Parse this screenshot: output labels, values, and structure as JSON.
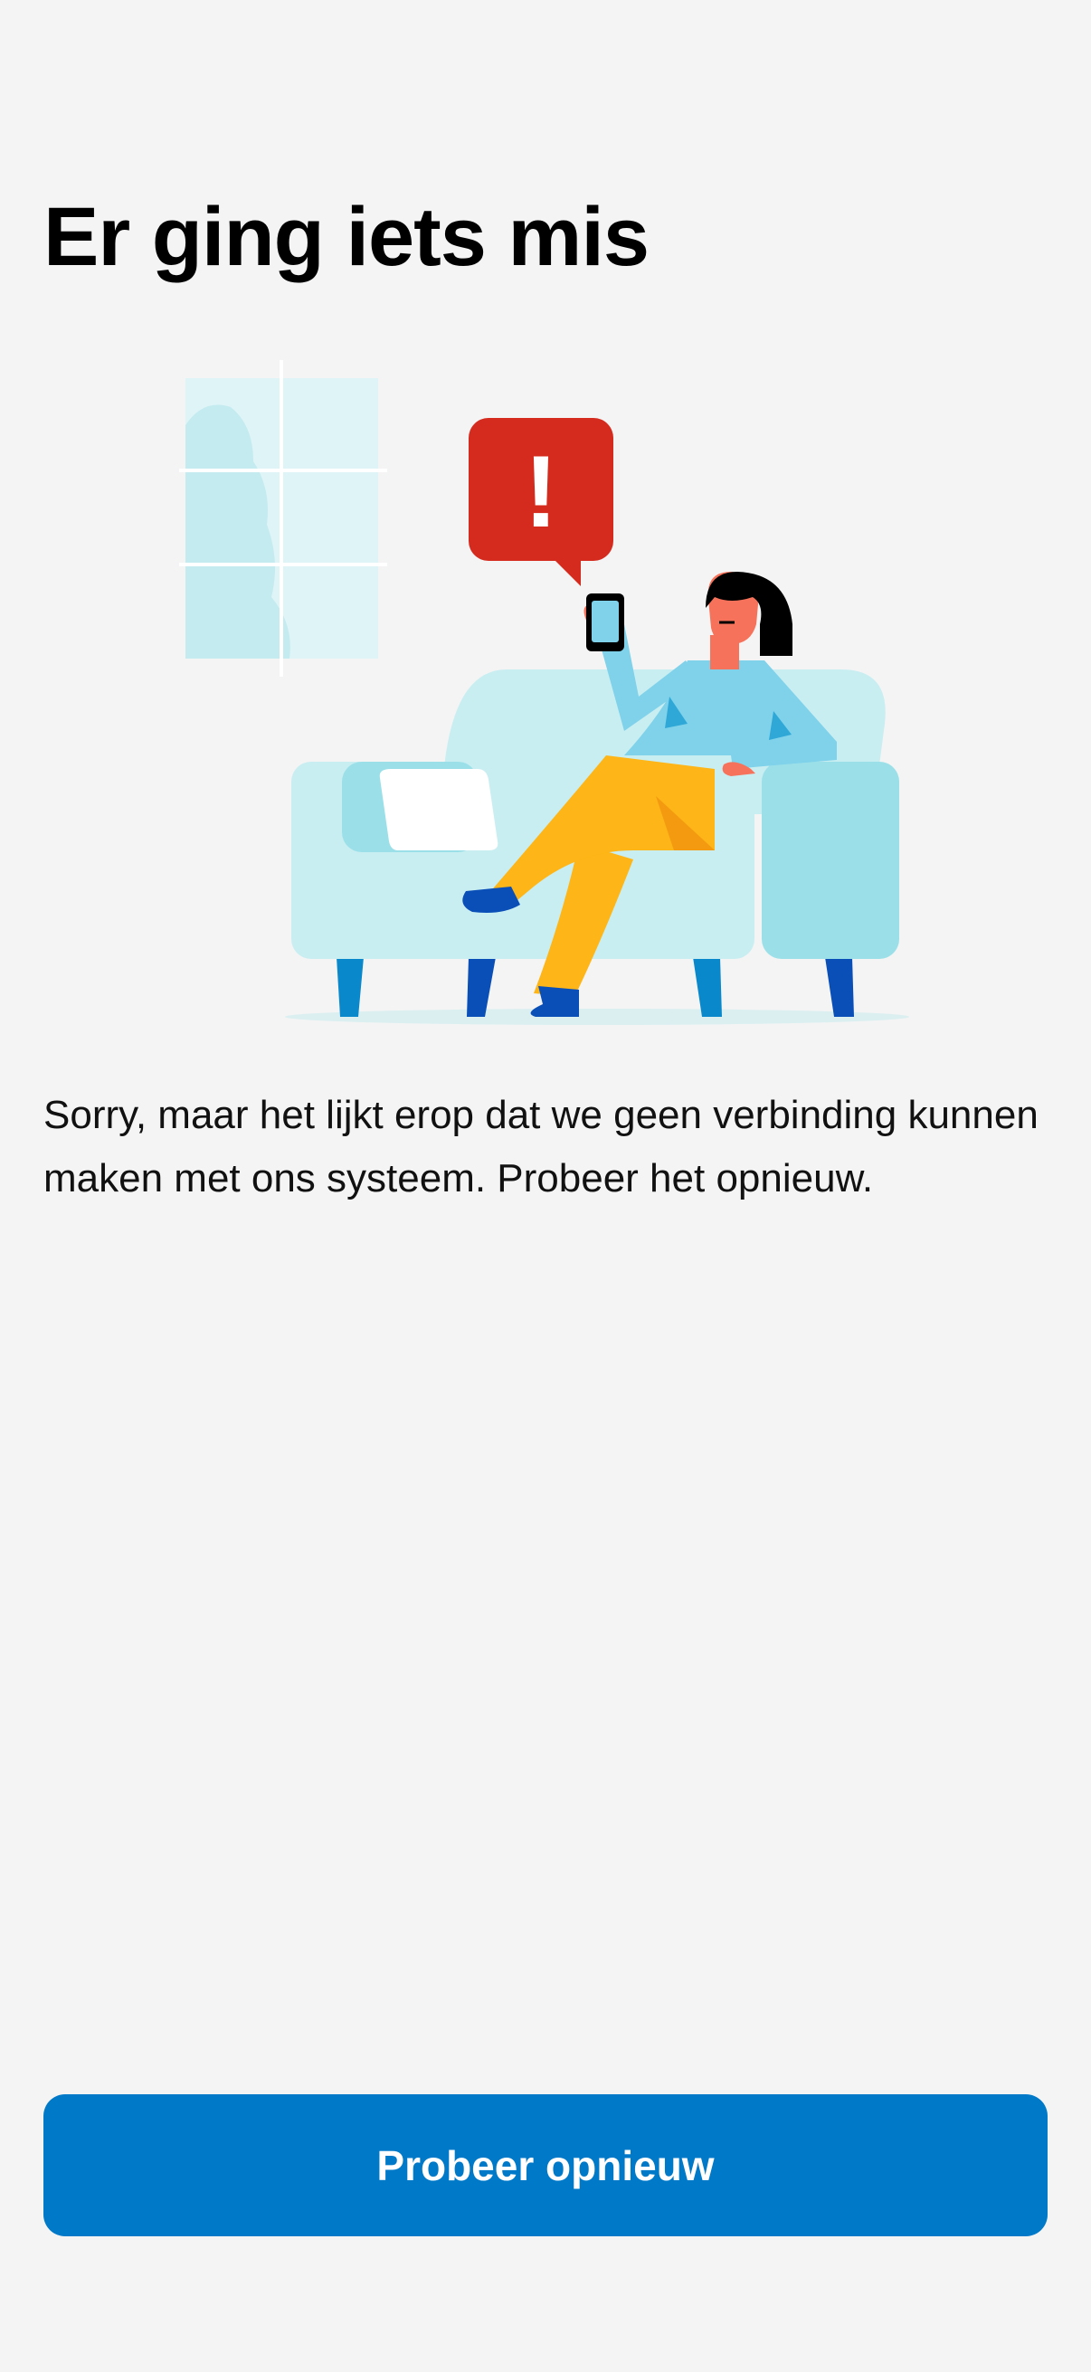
{
  "page": {
    "title": "Er ging iets mis",
    "message": "Sorry, maar het lijkt erop dat we geen verbinding kunnen maken met ons systeem. Probeer het opnieuw.",
    "retry_label": "Probeer opnieuw",
    "illustration_alert_symbol": "!"
  },
  "colors": {
    "background": "#f4f4f4",
    "button": "#0079c8",
    "button_text": "#ffffff",
    "alert_bubble": "#d52b1e",
    "sofa": "#c9eef2",
    "sofa_arm": "#9be0e8",
    "sofa_legs": "#0a4fb8",
    "shirt": "#7fd2ea",
    "trousers": "#fdb517",
    "skin": "#f7725a"
  },
  "icons": {
    "alert": "exclamation-alert-icon"
  }
}
